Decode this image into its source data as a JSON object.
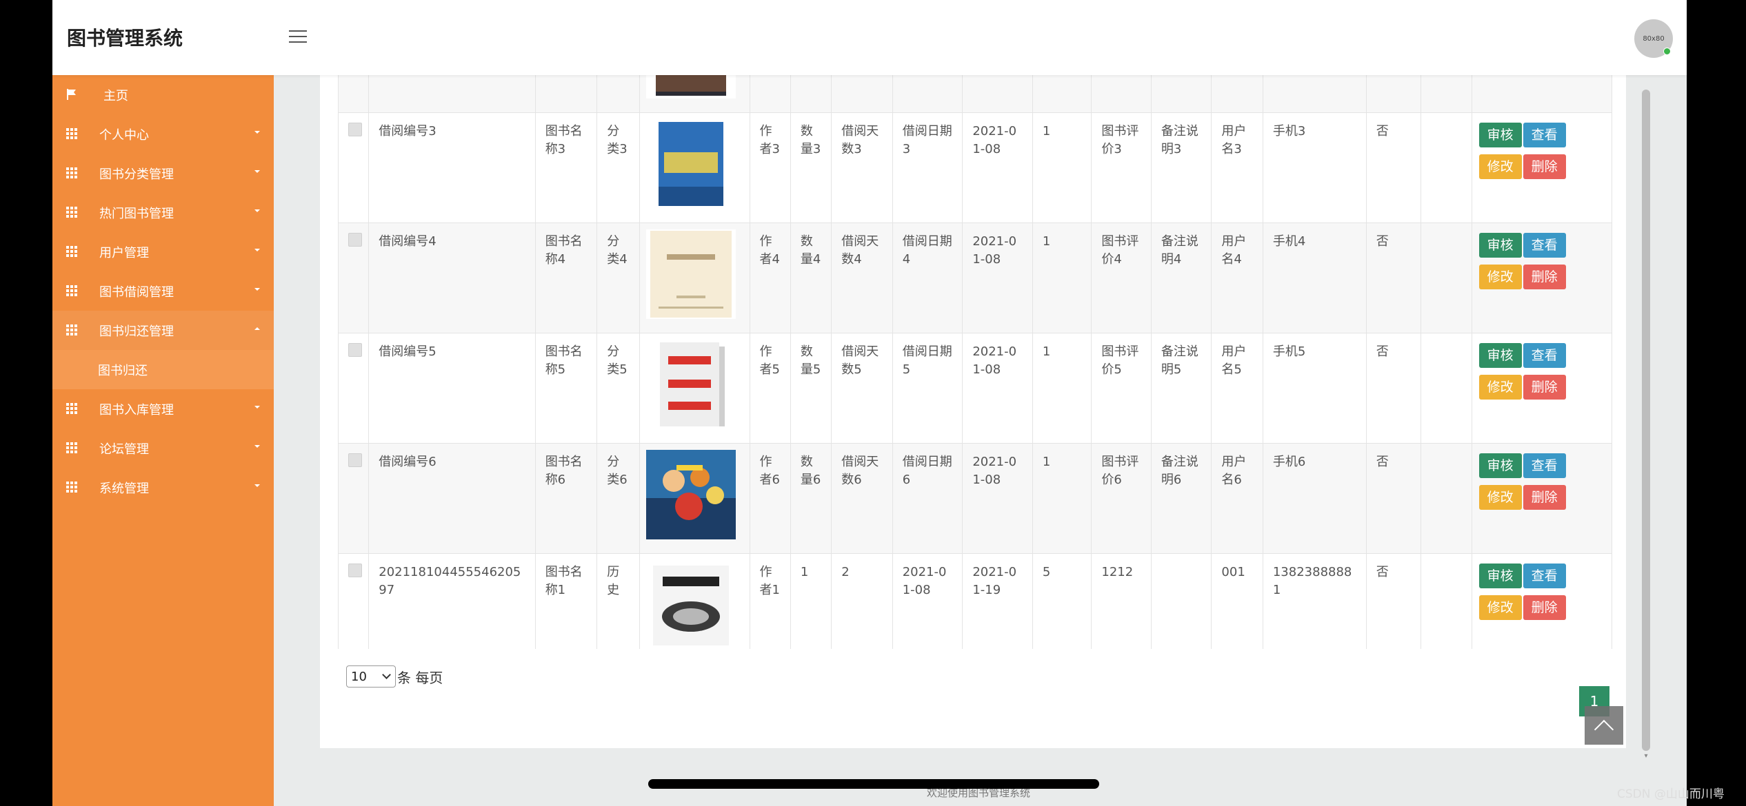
{
  "header": {
    "brand": "图书管理系统",
    "avatar_text": "80x80"
  },
  "sidebar": {
    "items": [
      {
        "label": "主页",
        "icon": "flag-icon",
        "expanded": false
      },
      {
        "label": "个人中心",
        "icon": "grid-icon",
        "expanded": false
      },
      {
        "label": "图书分类管理",
        "icon": "grid-icon",
        "expanded": false
      },
      {
        "label": "热门图书管理",
        "icon": "grid-icon",
        "expanded": false
      },
      {
        "label": "用户管理",
        "icon": "grid-icon",
        "expanded": false
      },
      {
        "label": "图书借阅管理",
        "icon": "grid-icon",
        "expanded": false
      },
      {
        "label": "图书归还管理",
        "icon": "grid-icon",
        "expanded": true,
        "sub": "图书归还"
      },
      {
        "label": "图书入库管理",
        "icon": "grid-icon",
        "expanded": false
      },
      {
        "label": "论坛管理",
        "icon": "grid-icon",
        "expanded": false
      },
      {
        "label": "系统管理",
        "icon": "grid-icon",
        "expanded": false
      }
    ]
  },
  "table": {
    "actions": {
      "approve": "审核",
      "view": "查看",
      "edit": "修改",
      "delete": "删除"
    },
    "rows": [
      {
        "id": "",
        "book": "",
        "cat": "",
        "author": "",
        "qty": "",
        "days": "",
        "date": "",
        "ret": "",
        "n": "",
        "rating": "",
        "note": "",
        "user": "",
        "phone": "",
        "flag": "",
        "cover": "dark"
      },
      {
        "id": "借阅编号3",
        "book": "图书名称3",
        "cat": "分类3",
        "author": "作者3",
        "qty": "数量3",
        "days": "借阅天数3",
        "date": "借阅日期3",
        "ret": "2021-01-08",
        "n": "1",
        "rating": "图书评价3",
        "note": "备注说明3",
        "user": "用户名3",
        "phone": "手机3",
        "flag": "否",
        "cover": "blue"
      },
      {
        "id": "借阅编号4",
        "book": "图书名称4",
        "cat": "分类4",
        "author": "作者4",
        "qty": "数量4",
        "days": "借阅天数4",
        "date": "借阅日期4",
        "ret": "2021-01-08",
        "n": "1",
        "rating": "图书评价4",
        "note": "备注说明4",
        "user": "用户名4",
        "phone": "手机4",
        "flag": "否",
        "cover": "cream"
      },
      {
        "id": "借阅编号5",
        "book": "图书名称5",
        "cat": "分类5",
        "author": "作者5",
        "qty": "数量5",
        "days": "借阅天数5",
        "date": "借阅日期5",
        "ret": "2021-01-08",
        "n": "1",
        "rating": "图书评价5",
        "note": "备注说明5",
        "user": "用户名5",
        "phone": "手机5",
        "flag": "否",
        "cover": "red"
      },
      {
        "id": "借阅编号6",
        "book": "图书名称6",
        "cat": "分类6",
        "author": "作者6",
        "qty": "数量6",
        "days": "借阅天数6",
        "date": "借阅日期6",
        "ret": "2021-01-08",
        "n": "1",
        "rating": "图书评价6",
        "note": "备注说明6",
        "user": "用户名6",
        "phone": "手机6",
        "flag": "否",
        "cover": "anime"
      },
      {
        "id": "20211810445554620597",
        "book": "图书名称1",
        "cat": "历史",
        "author": "作者1",
        "qty": "1",
        "days": "2",
        "date": "2021-01-08",
        "ret": "2021-01-19",
        "n": "5",
        "rating": "1212",
        "note": "",
        "user": "001",
        "phone": "13823888881",
        "flag": "否",
        "cover": "white"
      }
    ]
  },
  "pagination": {
    "page_size": "10",
    "per_page_label": "条 每页",
    "current_page": "1"
  },
  "footer": {
    "text": "欢迎使用图书管理系统"
  },
  "watermark": "CSDN @山山而川粤",
  "colors": {
    "sidebar": "#f28c3c",
    "approve": "#2f8f64",
    "view": "#3a98c6",
    "edit": "#f0b132",
    "delete": "#e8615a"
  }
}
